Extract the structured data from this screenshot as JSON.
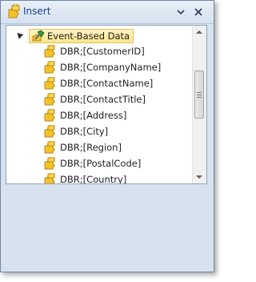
{
  "window": {
    "title": "Insert",
    "title_icon": "puzzle-icon",
    "dropdown_icon": "chevron-down-icon",
    "close_icon": "close-icon"
  },
  "tree": {
    "root": {
      "label": "Event-Based Data",
      "icon": "data-source-icon",
      "expanded": true,
      "selected": true
    },
    "children": [
      {
        "label": "DBR;[CustomerID]",
        "icon": "field-icon"
      },
      {
        "label": "DBR;[CompanyName]",
        "icon": "field-icon"
      },
      {
        "label": "DBR;[ContactName]",
        "icon": "field-icon"
      },
      {
        "label": "DBR;[ContactTitle]",
        "icon": "field-icon"
      },
      {
        "label": "DBR;[Address]",
        "icon": "field-icon"
      },
      {
        "label": "DBR;[City]",
        "icon": "field-icon"
      },
      {
        "label": "DBR;[Region]",
        "icon": "field-icon"
      },
      {
        "label": "DBR;[PostalCode]",
        "icon": "field-icon"
      },
      {
        "label": "DBR;[Country]",
        "icon": "field-icon"
      }
    ]
  },
  "colors": {
    "panel_bg": "#d7e2ee",
    "title_text": "#15428b",
    "selection_bg": "#ffe58d",
    "selection_border": "#e3c25a",
    "puzzle_yellow": "#f3c22a"
  }
}
